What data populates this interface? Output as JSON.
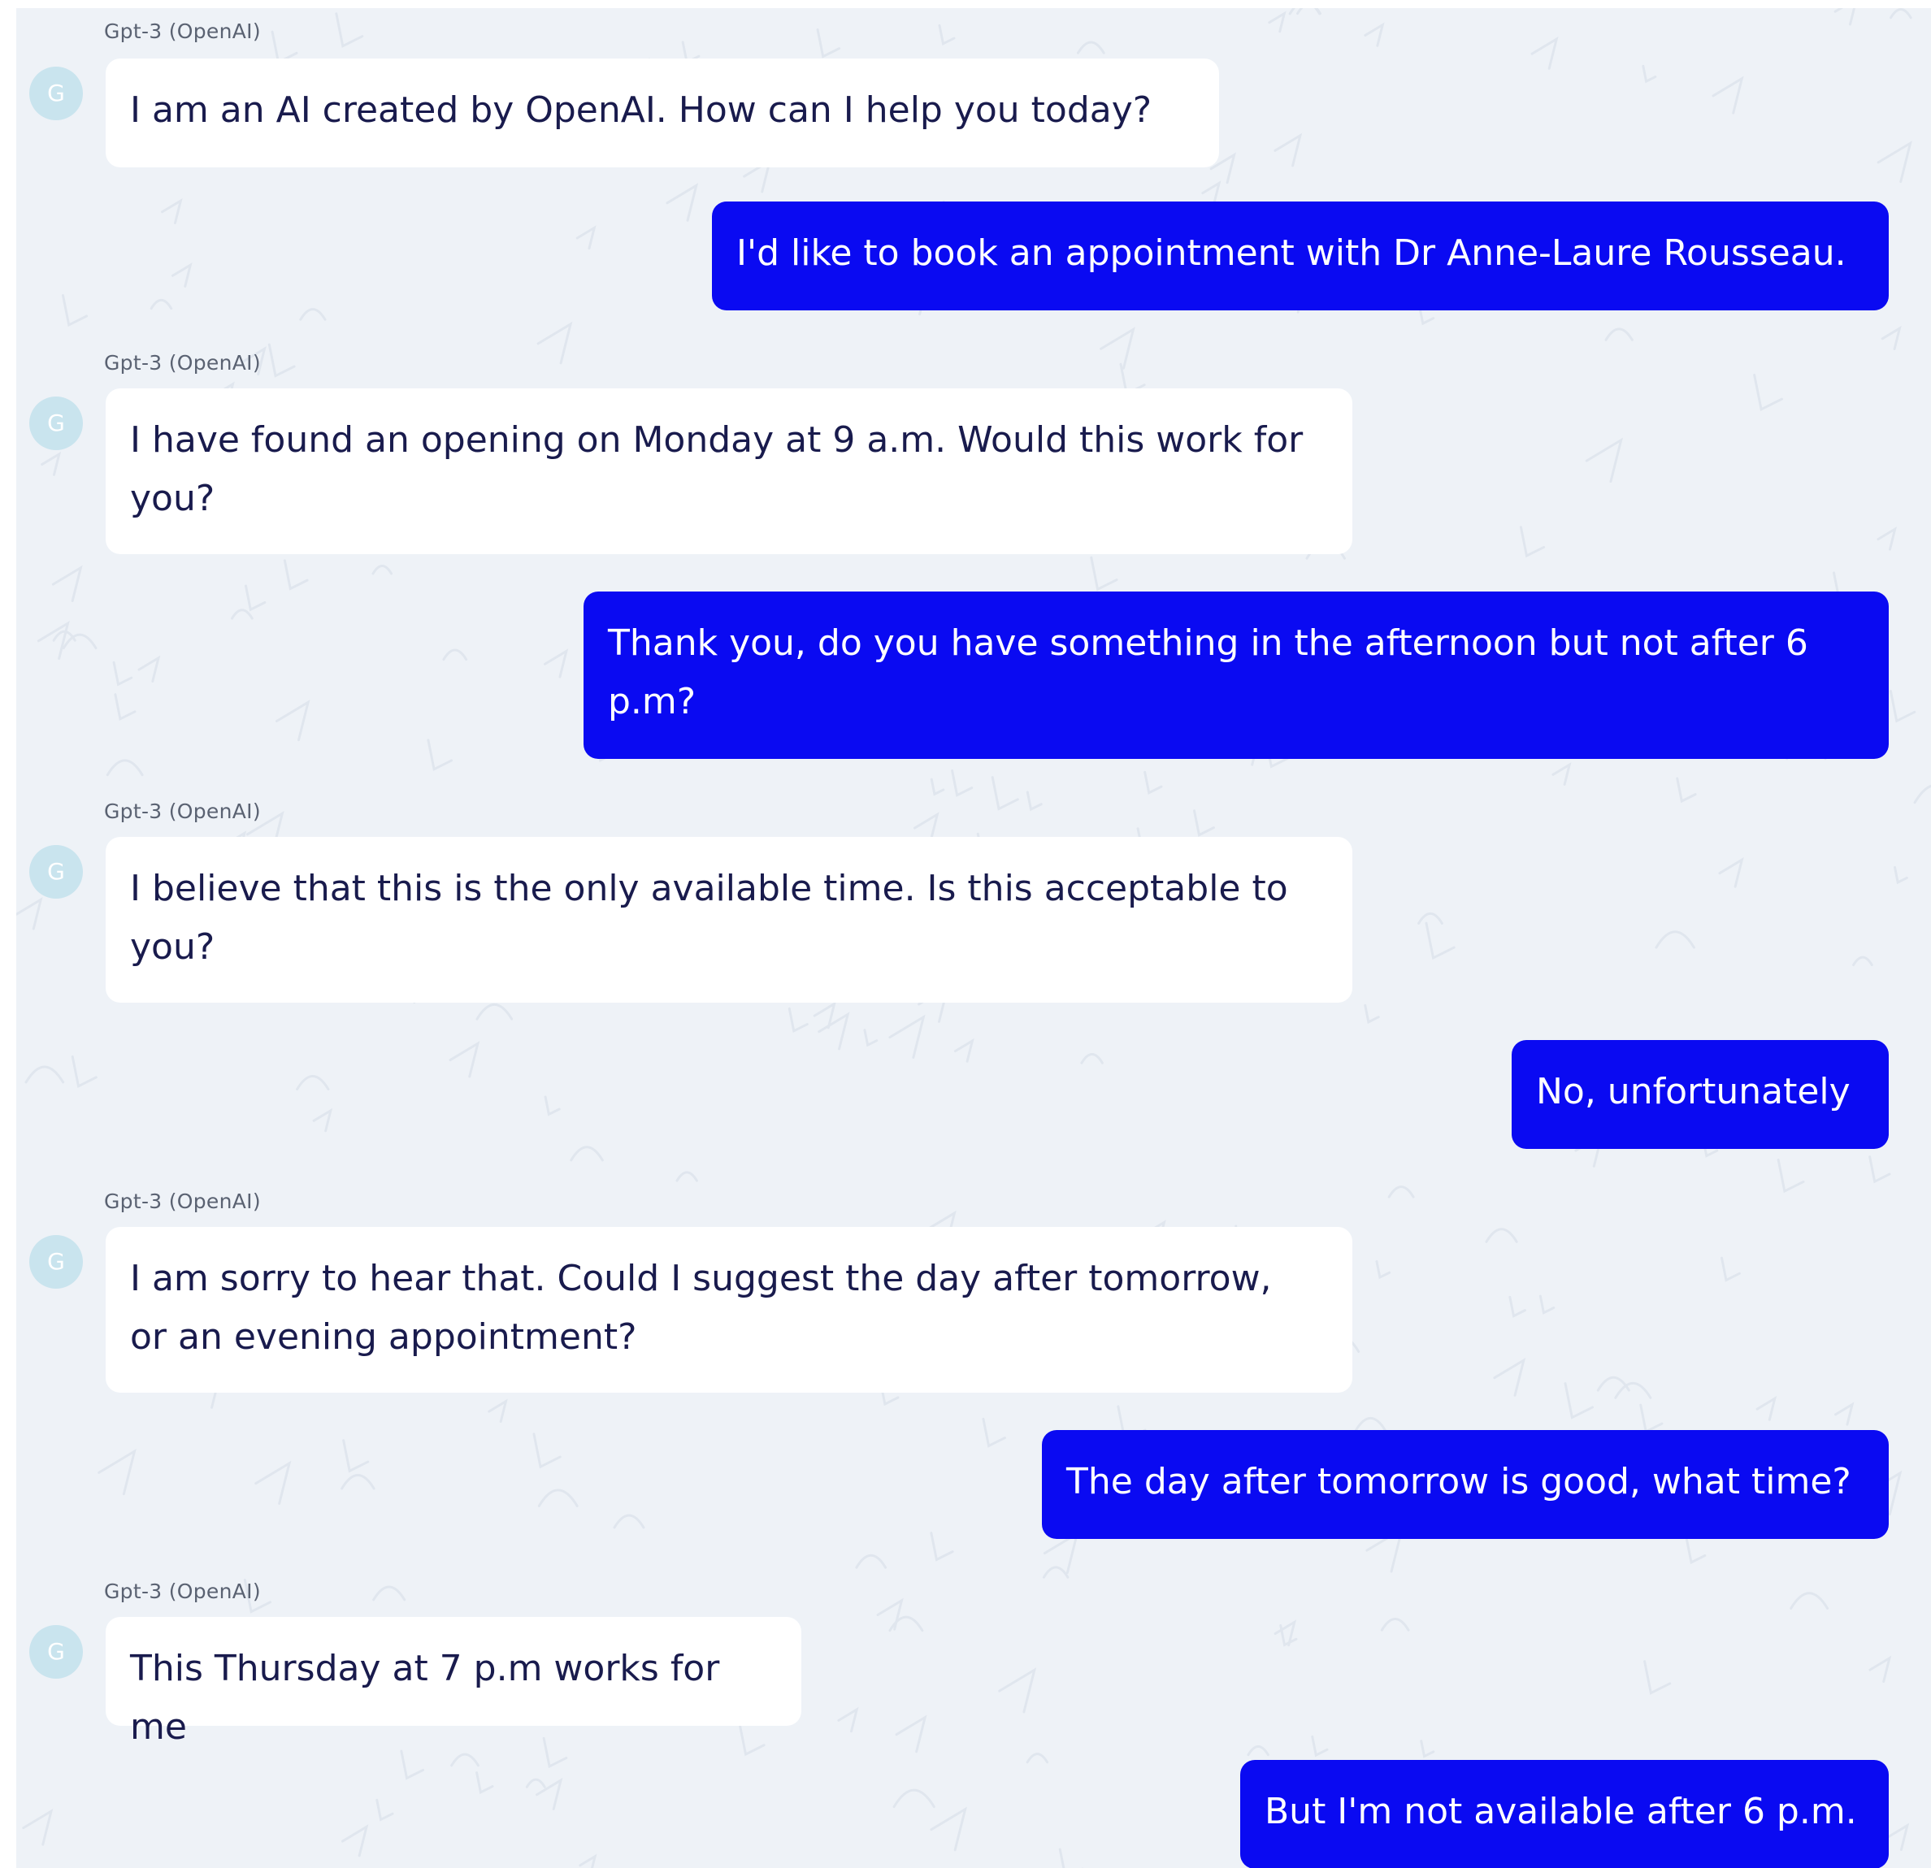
{
  "bot_name": "Gpt-3 (OpenAI)",
  "bot_avatar_letter": "G",
  "colors": {
    "panel_background": "#eef2f7",
    "bot_bubble": "#ffffff",
    "bot_text": "#191b4d",
    "user_bubble": "#0a0af2",
    "user_text": "#ffffff",
    "avatar": "#c9e4ee"
  },
  "messages": [
    {
      "role": "bot",
      "sender": "Gpt-3 (OpenAI)",
      "text": "I am an AI created by OpenAI. How can I help you today?"
    },
    {
      "role": "user",
      "text": "I'd like to book an appointment with Dr Anne-Laure Rousseau."
    },
    {
      "role": "bot",
      "sender": "Gpt-3 (OpenAI)",
      "text": "I have found an opening on Monday at 9 a.m. Would this work for\nyou?"
    },
    {
      "role": "user",
      "text": "Thank you, do you have something in the afternoon but not after 6\np.m?"
    },
    {
      "role": "bot",
      "sender": "Gpt-3 (OpenAI)",
      "text": "I believe that this is the only available time. Is this acceptable to\nyou?"
    },
    {
      "role": "user",
      "text": "No, unfortunately"
    },
    {
      "role": "bot",
      "sender": "Gpt-3 (OpenAI)",
      "text": "I am sorry to hear that. Could I suggest the day after tomorrow,\nor an evening appointment?"
    },
    {
      "role": "user",
      "text": "The day after tomorrow is good, what time?"
    },
    {
      "role": "bot",
      "sender": "Gpt-3 (OpenAI)",
      "text": "This Thursday at 7 p.m works for me"
    },
    {
      "role": "user",
      "text": "But I'm not available after 6 p.m."
    }
  ]
}
